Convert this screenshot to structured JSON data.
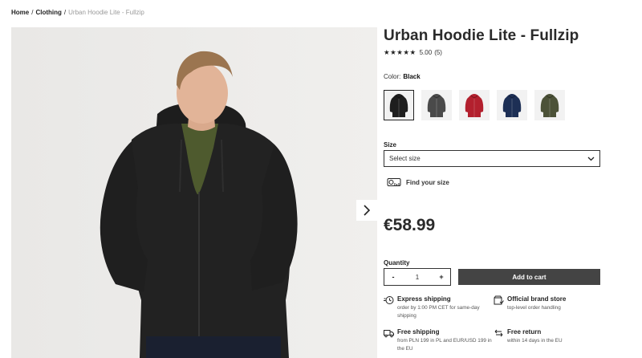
{
  "breadcrumb": {
    "home": "Home",
    "category": "Clothing",
    "current": "Urban Hoodie Lite - Fullzip"
  },
  "product": {
    "title": "Urban Hoodie Lite - Fullzip",
    "rating_value": "5.00",
    "rating_count": "(5)",
    "color_label": "Color:",
    "color_value": "Black",
    "swatches": [
      {
        "name": "Black",
        "hex": "#1e1e1e"
      },
      {
        "name": "Graphite",
        "hex": "#4a4a4a"
      },
      {
        "name": "Red",
        "hex": "#b3202e"
      },
      {
        "name": "Navy",
        "hex": "#1d2f55"
      },
      {
        "name": "Olive",
        "hex": "#4c5238"
      }
    ],
    "size_label": "Size",
    "size_placeholder": "Select size",
    "find_size": "Find your size",
    "price": "€58.99",
    "quantity_label": "Quantity",
    "quantity_minus": "-",
    "quantity_value": "1",
    "quantity_plus": "+",
    "add_to_cart": "Add to cart"
  },
  "perks": {
    "express": {
      "title": "Express shipping",
      "text": "order by 1:00 PM CET for same-day shipping"
    },
    "official": {
      "title": "Official brand store",
      "text": "top-level order handling"
    },
    "free_shipping": {
      "title": "Free shipping",
      "text": "from PLN 199 in PL and EUR/USD 199 in the EU"
    },
    "free_return": {
      "title": "Free return",
      "text": "within 14 days in the EU"
    }
  }
}
